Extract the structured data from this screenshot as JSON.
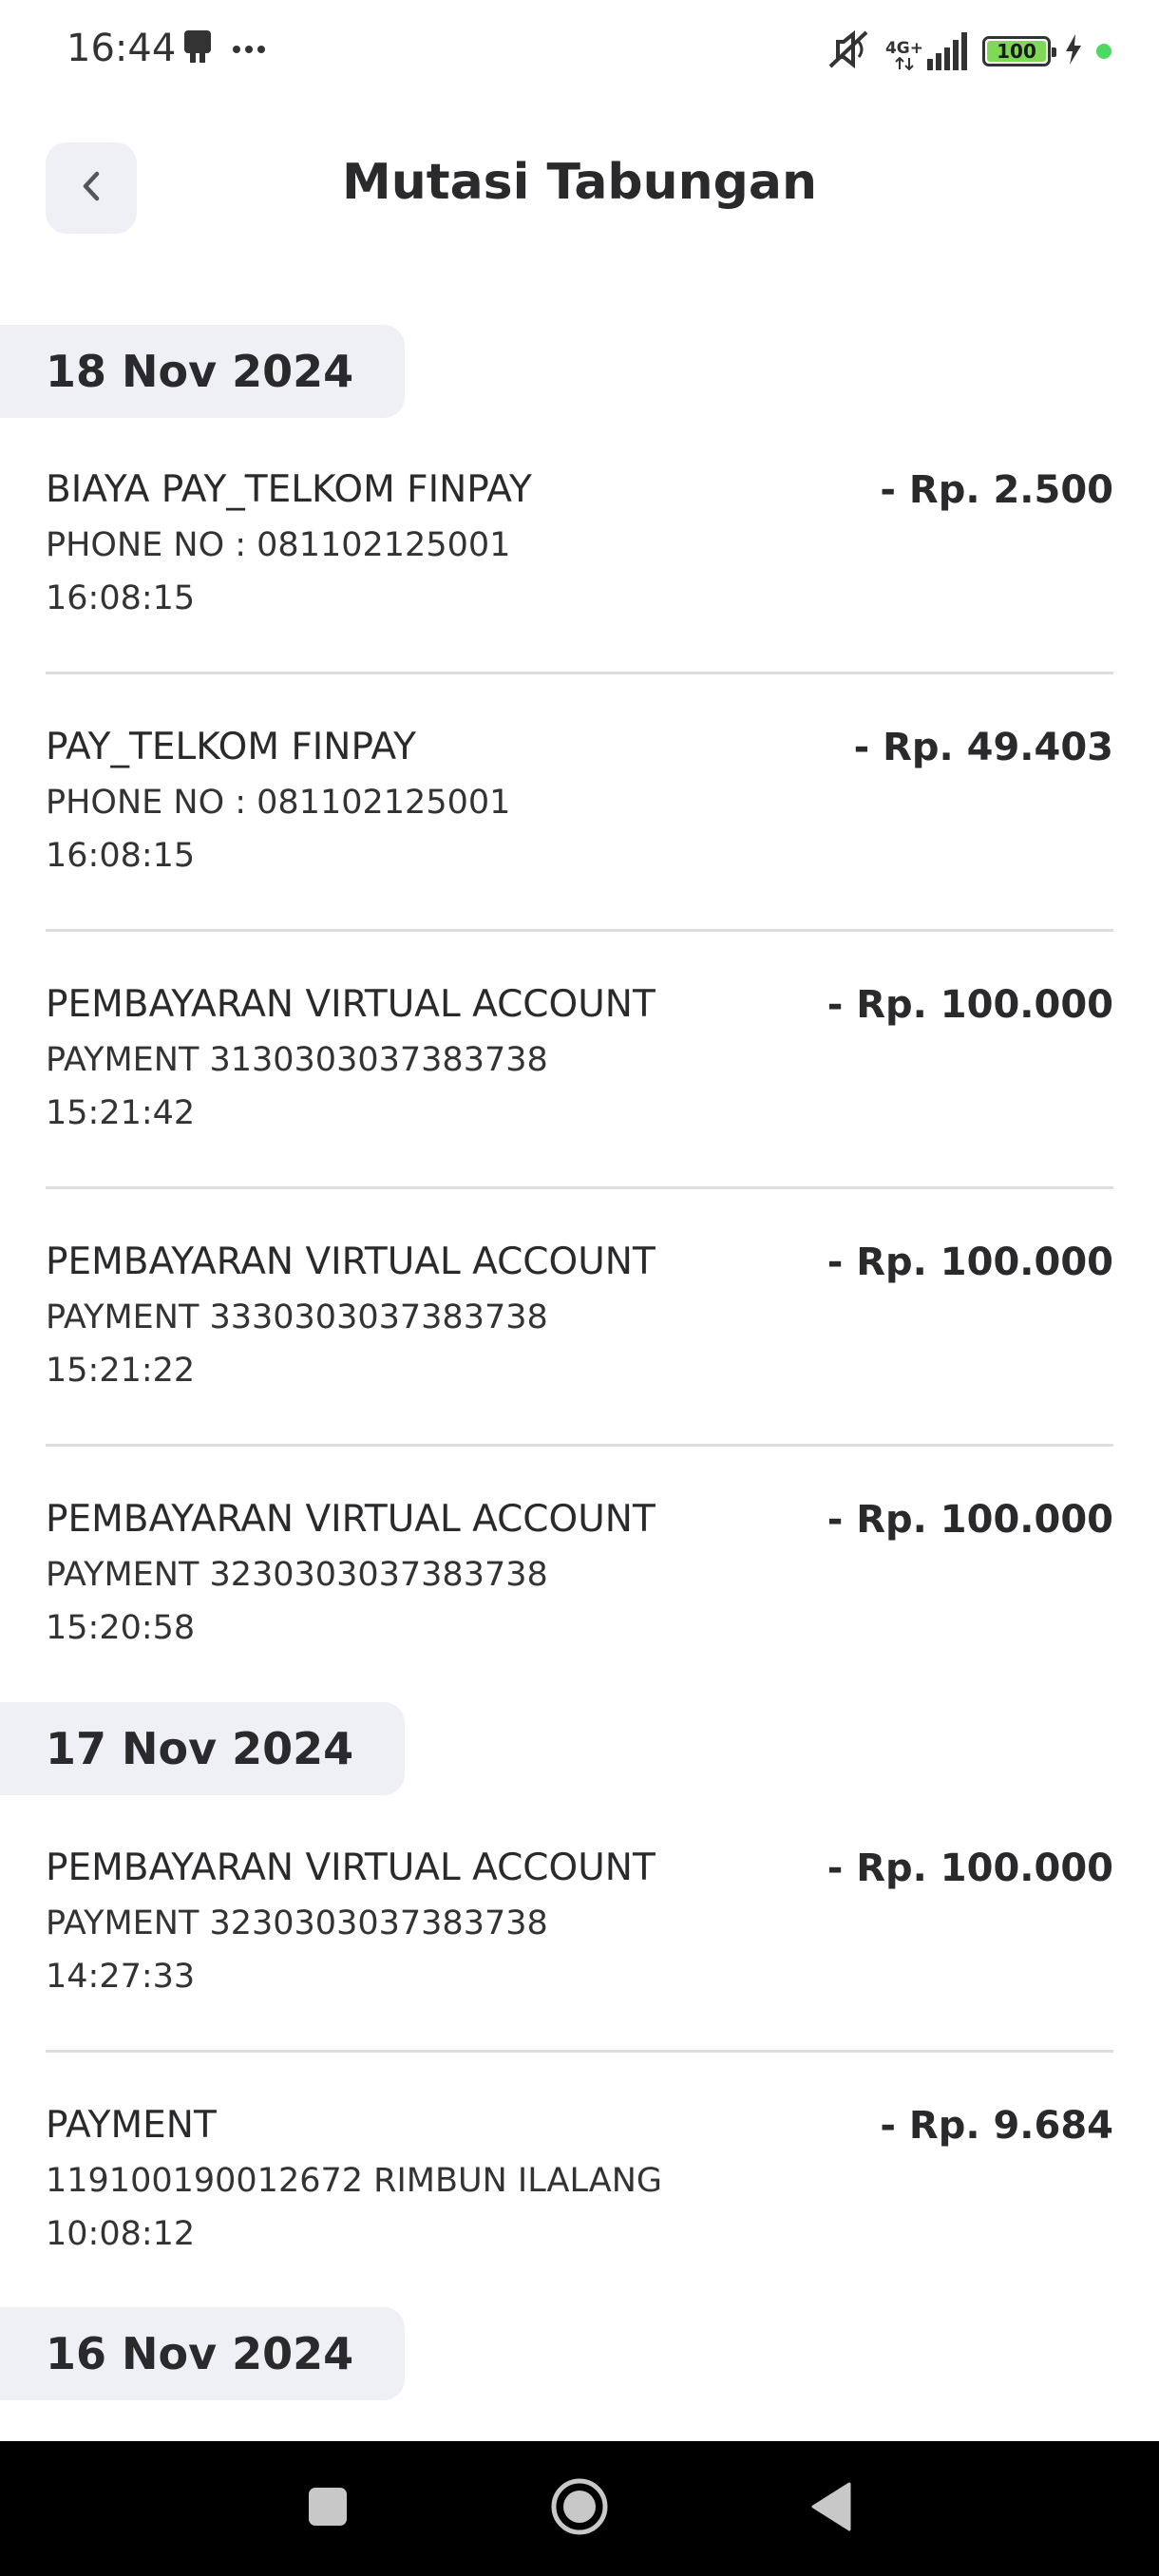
{
  "status_bar": {
    "time": "16:44",
    "network": "4G+",
    "battery": "100",
    "icons": [
      "notification-icon",
      "more-dots-icon",
      "mute-icon",
      "signal-icon",
      "battery-icon",
      "charging-icon"
    ]
  },
  "header": {
    "title": "Mutasi Tabungan",
    "back_icon": "chevron-left-icon"
  },
  "groups": [
    {
      "date": "18 Nov 2024",
      "transactions": [
        {
          "title": "BIAYA PAY_TELKOM FINPAY",
          "amount": "- Rp. 2.500",
          "detail": "PHONE NO : 081102125001",
          "time": "16:08:15"
        },
        {
          "title": "PAY_TELKOM FINPAY",
          "amount": "- Rp. 49.403",
          "detail": "PHONE NO : 081102125001",
          "time": "16:08:15"
        },
        {
          "title": "PEMBAYARAN VIRTUAL ACCOUNT",
          "amount": "- Rp. 100.000",
          "detail": "PAYMENT 3130303037383738",
          "time": "15:21:42"
        },
        {
          "title": "PEMBAYARAN VIRTUAL ACCOUNT",
          "amount": "- Rp. 100.000",
          "detail": "PAYMENT 3330303037383738",
          "time": "15:21:22"
        },
        {
          "title": "PEMBAYARAN VIRTUAL ACCOUNT",
          "amount": "- Rp. 100.000",
          "detail": "PAYMENT 3230303037383738",
          "time": "15:20:58"
        }
      ]
    },
    {
      "date": "17 Nov 2024",
      "transactions": [
        {
          "title": "PEMBAYARAN VIRTUAL ACCOUNT",
          "amount": "- Rp. 100.000",
          "detail": "PAYMENT 3230303037383738",
          "time": "14:27:33"
        },
        {
          "title": "PAYMENT",
          "amount": "- Rp. 9.684",
          "detail": "119100190012672 RIMBUN ILALANG",
          "time": "10:08:12"
        }
      ]
    },
    {
      "date": "16 Nov 2024",
      "transactions": []
    }
  ],
  "nav_bar": {
    "icons": [
      "recents-icon",
      "home-icon",
      "back-icon"
    ]
  }
}
